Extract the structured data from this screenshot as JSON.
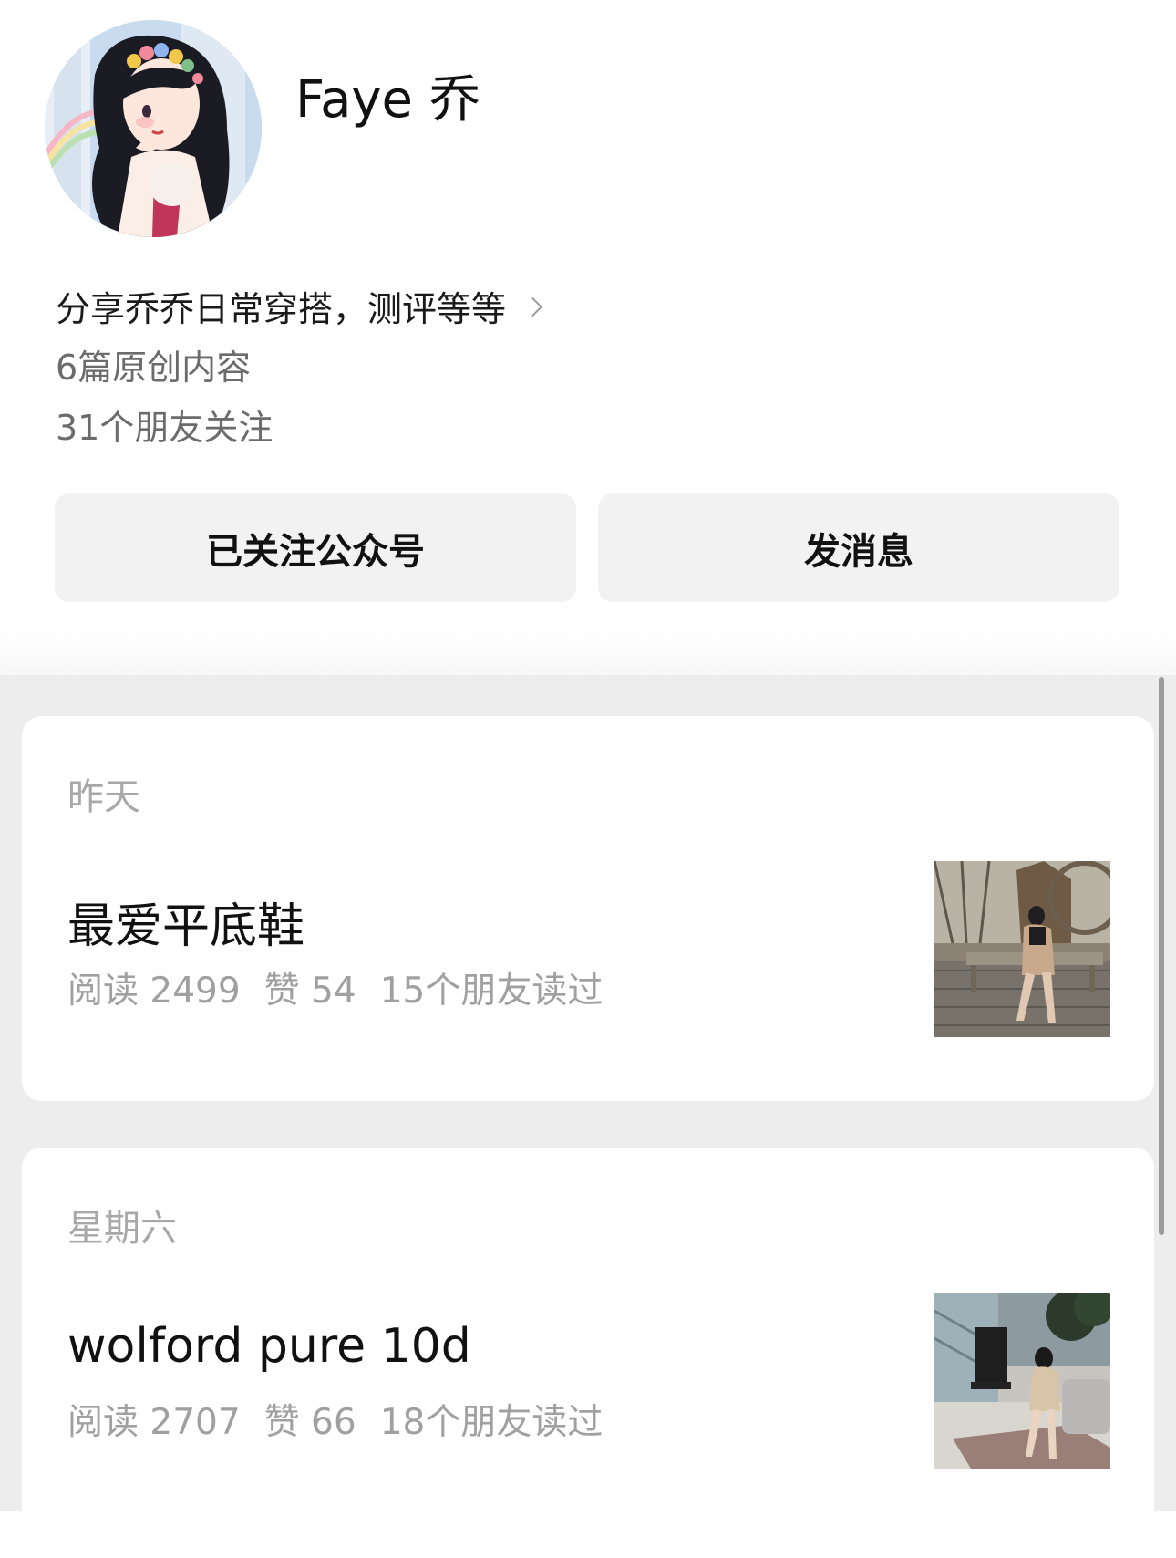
{
  "profile": {
    "name": "Faye 乔",
    "bio": "分享乔乔日常穿搭，测评等等",
    "original_count_text": "6篇原创内容",
    "friends_follow_text": "31个朋友关注"
  },
  "actions": {
    "follow_label": "已关注公众号",
    "message_label": "发消息"
  },
  "feed": {
    "items": [
      {
        "date": "昨天",
        "title": "最爱平底鞋",
        "reads": "阅读 2499",
        "likes": "赞 54",
        "friends_read": "15个朋友读过"
      },
      {
        "date": "星期六",
        "title": "wolford pure 10d",
        "reads": "阅读 2707",
        "likes": "赞 66",
        "friends_read": "18个朋友读过"
      }
    ]
  },
  "icons": {
    "bio_chevron": "chevron-right-icon"
  },
  "colors": {
    "button_bg": "#f2f2f2",
    "feed_bg": "#ededed",
    "secondary_text": "#6b6b6b",
    "muted_text": "#a0a0a0"
  }
}
